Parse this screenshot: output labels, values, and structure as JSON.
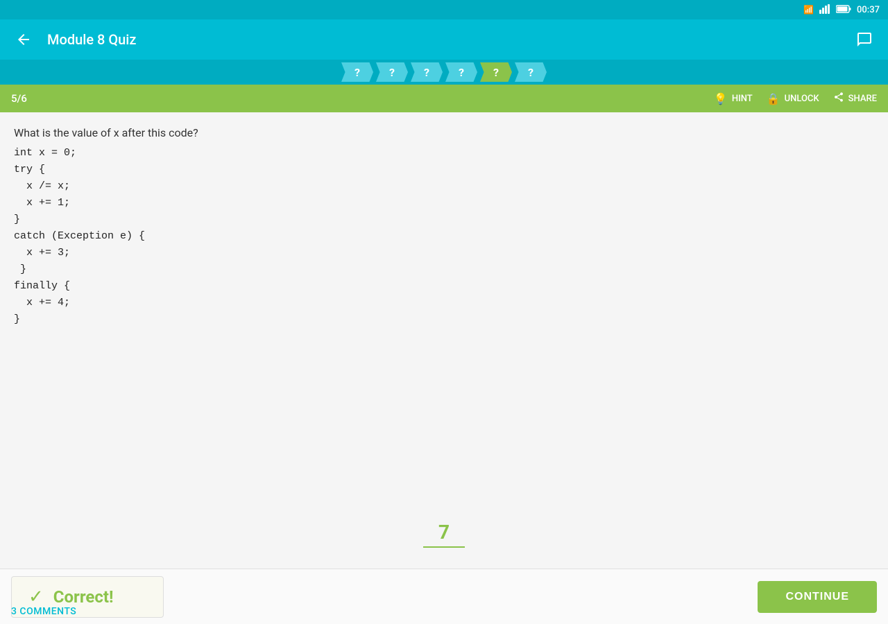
{
  "statusBar": {
    "time": "00:37",
    "wifiIcon": "📶",
    "signalIcon": "📡",
    "batteryIcon": "🔋"
  },
  "appBar": {
    "title": "Module 8 Quiz",
    "backIcon": "←",
    "chatIcon": "💬"
  },
  "progressBar": {
    "steps": [
      {
        "label": "?",
        "active": false
      },
      {
        "label": "?",
        "active": false
      },
      {
        "label": "?",
        "active": false
      },
      {
        "label": "?",
        "active": false
      },
      {
        "label": "?",
        "active": true
      },
      {
        "label": "?",
        "active": false
      }
    ]
  },
  "counterBar": {
    "counter": "5/6",
    "hint": "HINT",
    "unlock": "UNLOCK",
    "share": "SHARE"
  },
  "question": {
    "text": "What is the value of x after this code?",
    "code": "int x = 0;\ntry {\n  x /= x;\n  x += 1;\n}\ncatch (Exception e) {\n  x += 3;\n }\nfinally {\n  x += 4;\n}"
  },
  "answer": {
    "value": "7"
  },
  "correctBanner": {
    "checkIcon": "✓",
    "text": "Correct!"
  },
  "bottomBar": {
    "commentsLabel": "3 COMMENTS",
    "continueLabel": "CONTINUE"
  }
}
